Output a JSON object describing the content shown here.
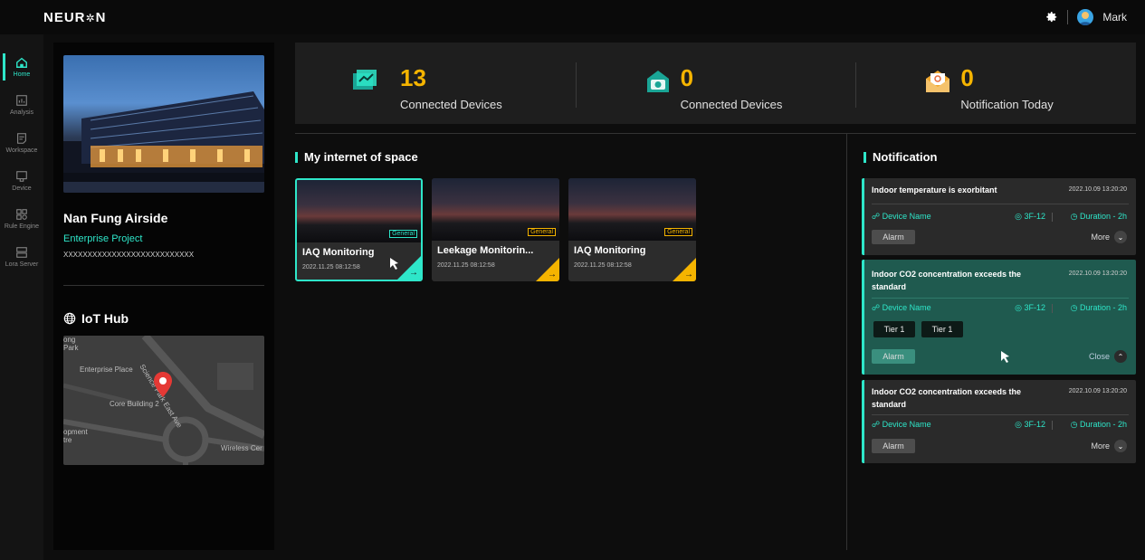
{
  "app": {
    "logo": "NEUR",
    "logo_atom": "✲",
    "logo_tail": "N",
    "user_name": "Mark"
  },
  "sidebar": {
    "items": [
      {
        "label": "Home"
      },
      {
        "label": "Analysis"
      },
      {
        "label": "Workspace"
      },
      {
        "label": "Device"
      },
      {
        "label": "Rule Engine"
      },
      {
        "label": "Lora Server"
      }
    ]
  },
  "project": {
    "name": "Nan Fung Airside",
    "type": "Enterprise Project",
    "code": "XXXXXXXXXXXXXXXXXXXXXXXXXXX",
    "hub_title": "IoT Hub",
    "map_labels": [
      "ong",
      "Park",
      "Enterprise Place",
      "Core Building 2",
      "opment",
      "tre",
      "Wireless Cer",
      "Science Park East Ave"
    ]
  },
  "stats": [
    {
      "value": "13",
      "label": "Connected Devices"
    },
    {
      "value": "0",
      "label": "Connected Devices"
    },
    {
      "value": "0",
      "label": "Notification Today"
    }
  ],
  "spaces": {
    "title": "My internet of space",
    "cards": [
      {
        "title": "IAQ Monitoring",
        "date": "2022.11.25 08:12:58",
        "tag": "General",
        "arrow": "→"
      },
      {
        "title": "Leekage Monitorin...",
        "date": "2022.11.25 08:12:58",
        "tag": "General",
        "arrow": "→"
      },
      {
        "title": "IAQ Monitoring",
        "date": "2022.11.25 08:12:58",
        "tag": "General",
        "arrow": "→"
      }
    ]
  },
  "notifications": {
    "title": "Notification",
    "items": [
      {
        "title": "Indoor temperature is exorbitant",
        "time": "2022.10.09 13:20:20",
        "device": "Device Name",
        "location": "3F-12",
        "duration": "Duration - 2h",
        "alarm": "Alarm",
        "toggle": "More",
        "chevron": "⌄"
      },
      {
        "title": "Indoor CO2 concentration exceeds the standard",
        "time": "2022.10.09 13:20:20",
        "device": "Device Name",
        "location": "3F-12",
        "duration": "Duration - 2h",
        "alarm": "Alarm",
        "toggle": "Close",
        "chevron": "⌃",
        "tiers": [
          "Tier 1",
          "Tier 1"
        ]
      },
      {
        "title": "Indoor CO2 concentration exceeds the standard",
        "time": "2022.10.09 13:20:20",
        "device": "Device Name",
        "location": "3F-12",
        "duration": "Duration - 2h",
        "alarm": "Alarm",
        "toggle": "More",
        "chevron": "⌄"
      }
    ]
  },
  "colors": {
    "accent": "#2ee6c9",
    "value": "#f5b400",
    "panel": "#1e1e1e",
    "expanded": "#1f5a4f"
  }
}
